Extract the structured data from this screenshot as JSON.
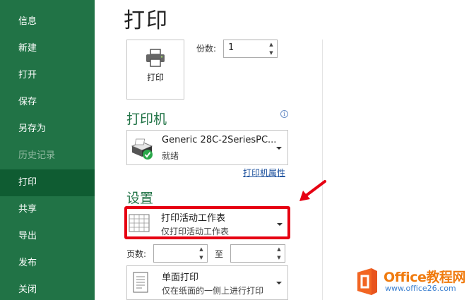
{
  "sidebar": {
    "items": [
      {
        "label": "信息",
        "state": "normal"
      },
      {
        "label": "新建",
        "state": "normal"
      },
      {
        "label": "打开",
        "state": "normal"
      },
      {
        "label": "保存",
        "state": "normal"
      },
      {
        "label": "另存为",
        "state": "normal"
      },
      {
        "label": "历史记录",
        "state": "disabled"
      },
      {
        "label": "打印",
        "state": "active"
      },
      {
        "label": "共享",
        "state": "normal"
      },
      {
        "label": "导出",
        "state": "normal"
      },
      {
        "label": "发布",
        "state": "normal"
      },
      {
        "label": "关闭",
        "state": "normal"
      }
    ]
  },
  "main": {
    "title": "打印",
    "print_button_label": "打印",
    "copies_label": "份数:",
    "copies_value": "1",
    "printer_heading": "打印机",
    "printer_name": "Generic 28C-2SeriesPC...",
    "printer_status": "就绪",
    "printer_properties_link": "打印机属性",
    "settings_heading": "设置",
    "scope_title": "打印活动工作表",
    "scope_desc": "仅打印活动工作表",
    "pages_label": "页数:",
    "pages_from": "",
    "to_label": "至",
    "pages_to": "",
    "sides_title": "单面打印",
    "sides_desc": "仅在纸面的一侧上进行打印"
  },
  "watermark": {
    "title": "Office教程网",
    "url": "www.office26.com"
  },
  "colors": {
    "sidebar_bg": "#217346",
    "sidebar_active": "#0f5c32",
    "heading_green": "#217346",
    "highlight_red": "#e60012"
  }
}
